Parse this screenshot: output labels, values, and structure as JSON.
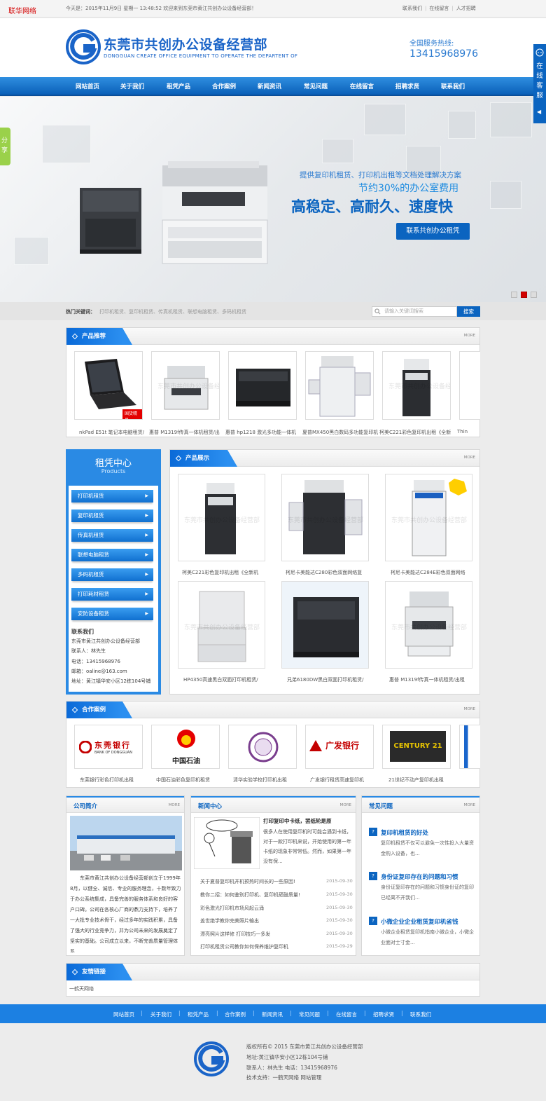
{
  "top_bar": {
    "site_tag": "联华网络",
    "welcome": "今天是：2015年11月9日 星期一 13:48:52 欢迎来到东莞市黄江共创办公设备经营部！",
    "links": [
      "联系我们",
      "在线留言",
      "人才招聘"
    ]
  },
  "header": {
    "company_cn": "东莞市共创办公设备经营部",
    "company_en": "DONGGUAN CREATE OFFICE EQUIPMENT TO OPERATE THE DEPARTENT OF",
    "hotline_label": "全国服务热线:",
    "hotline_number": "13415968976"
  },
  "nav": {
    "items": [
      "网站首页",
      "关于我们",
      "租凭产品",
      "合作案例",
      "新闻资讯",
      "常见问题",
      "在线留言",
      "招聘求贤",
      "联系我们"
    ]
  },
  "banner": {
    "line1": "提供复印机租赁、打印机出租等文档处理解决方案",
    "line2": "节约30%的办公室费用",
    "line3": "高稳定、高耐久、速度快",
    "button": "联系共创办公租凭",
    "active_slide": 2
  },
  "hot_keywords": {
    "label": "热门关键词：",
    "items": "打印机租赁、复印机租赁、传真机租赁、联想电脑租赁、多码机租赁"
  },
  "search": {
    "placeholder": "请输入关键词搜索",
    "button": "搜索"
  },
  "recommend": {
    "title": "产品推荐",
    "more": "MORE",
    "items": [
      "nkPad E51t 笔记本电脑租赁/",
      "惠普 M1319f传真一体机租赁/出",
      "惠普 hp1218 激光多功能一体机",
      "夏普MX450黑白数码多功能复印机",
      "柯美C221彩色复印机出租《全新",
      "Thin"
    ],
    "badge": "国货精品"
  },
  "rent_center": {
    "title": "租凭中心",
    "subtitle": "Products",
    "items": [
      "打印机租赁",
      "复印机租赁",
      "传真机租赁",
      "联想电脑租赁",
      "多码机租赁",
      "打印耗材租赁",
      "安防设备租赁"
    ]
  },
  "contact": {
    "title": "联系我们",
    "company": "东莞市黄江共创办公设备经营部",
    "person": "联系人：林先生",
    "phone": "电话：13415968976",
    "email": "邮箱：oaline@163.com",
    "address": "地址：黄江镇华安小区12栋104号铺"
  },
  "products": {
    "title": "产品展示",
    "more": "MORE",
    "items": [
      "柯美C221彩色复印机出租《全新机",
      "柯尼卡美能达C280彩色双面网络复",
      "柯尼卡美能达C284E彩色双面网络",
      "HP4350高速黑白双面打印机租赁/",
      "兄弟6180DW黑白双面打印机租赁/",
      "惠普 M1319f传真一体机租赁/出租"
    ],
    "watermark": "东莞市共创办公设备经营部"
  },
  "cases": {
    "title": "合作案例",
    "more": "MORE",
    "items": [
      "东莞银行彩色打印机出租",
      "中国石油彩色复印机租赁",
      "清华实验学校打印机出租",
      "广发银行租赁高速复印机",
      "21世纪不动产复印机出租"
    ],
    "logos": [
      "东莞银行",
      "BANK OF DONGGUAN",
      "中国石油",
      "广发银行",
      "CENTURY 21"
    ]
  },
  "about": {
    "title": "公司简介",
    "more": "MORE",
    "text": "东莞市黄江共创办公设备经营部创立于1999年8月，以健全、诚信、专业的服务理念，十数年致力于办公系统集成，具备完善的服务体系和良好的客户口碑。公司在各核心厂商的鼎力支持下，培养了一大批专业技术骨干，经过多年的实践积累，具备了强大的行业竞争力，并为公司未来的发展奠定了坚实的基础。公司成立以来，不断完善质量管理体系..."
  },
  "news": {
    "title": "新闻中心",
    "more": "MORE",
    "headline": "打印复印中卡纸，罢纸轮是原",
    "summary": "很多人在使用复印机时可能会遇到卡纸，对于一款打印机来说，开始使用的第一年卡纸的现象非常常低。然而，如果第一年没有保...",
    "items": [
      {
        "t": "关于夏普复印机开机预热时间长的一些原因!",
        "d": "2015-09-30"
      },
      {
        "t": "教你二招：如何鉴别打印机、复印机硒鼓质量!",
        "d": "2015-09-30"
      },
      {
        "t": "彩色激光打印机市场风起云涌",
        "d": "2015-09-30"
      },
      {
        "t": "盖世绝学教你完美照片输出",
        "d": "2015-09-30"
      },
      {
        "t": "漂亮照片这样修 打印技巧一多发",
        "d": "2015-09-30"
      },
      {
        "t": "打印机租赁公司教你如何保养维护复印机",
        "d": "2015-09-29"
      }
    ]
  },
  "faq": {
    "title": "常见问题",
    "more": "MORE",
    "items": [
      {
        "q": "复印机租赁的好处",
        "a": "复印机租赁不仅可以避免一次性投入大量资金购入设备，也..."
      },
      {
        "q": "身份证复印存在的问题和习惯",
        "a": "身份证复印存在的问题和习惯身份证的复印已经离不开我们..."
      },
      {
        "q": "小微企业企业租赁复印机省钱",
        "a": "小微企业租赁复印机指南小微企业，小微企业面对士寸金..."
      }
    ]
  },
  "links": {
    "title": "友情链接",
    "items": [
      "一鹤天网络"
    ]
  },
  "footer": {
    "nav": [
      "网站首页",
      "关于我们",
      "租凭产品",
      "合作案例",
      "新闻资讯",
      "常见问题",
      "在线留言",
      "招聘求贤",
      "联系我们"
    ],
    "copyright": "版权所有© 2015 东莞市黄江共创办公设备经营部",
    "address": "地址:黄江镇华安小区12栋104号铺",
    "contact": "联系人：林先生 电话：13415968976",
    "support": "技术支持：一鹤天网络  网站管理"
  },
  "side": {
    "online": "在线客服",
    "share": "分享"
  },
  "colors": {
    "primary": "#0b64c0",
    "accent": "#2a8ae4",
    "nav": "#1a7ad8",
    "badge": "#e30000"
  }
}
